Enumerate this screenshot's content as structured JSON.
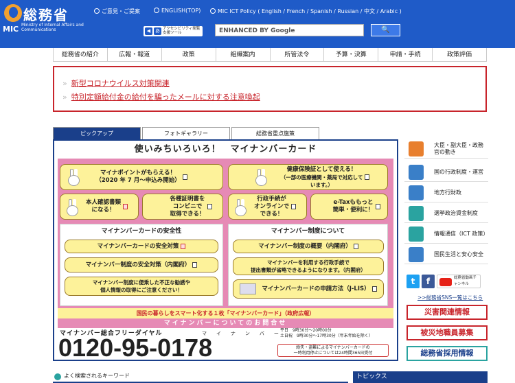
{
  "header": {
    "logo_jp": "総務省",
    "logo_mic": "MIC",
    "logo_en": "Ministry of Internal Affairs and Communications",
    "links": [
      "ご意見・ご提案",
      "ENGLISH(TOP)",
      "MIC ICT Policy ( English / French / Spanish / Russian / 中文 / Arabic )"
    ],
    "accessibility_label": "アクセシビリティ閲覧支援ツール",
    "search_placeholder": "ENHANCED BY Google",
    "search_button": "🔍"
  },
  "nav": [
    "総務省の紹介",
    "広報・報道",
    "政策",
    "組織案内",
    "所管法令",
    "予算・決算",
    "申請・手続",
    "政策評価"
  ],
  "notices": [
    "新型コロナウイルス対策関連",
    "特別定額給付金の給付を騙ったメールに対する注意喚起"
  ],
  "tabs": [
    "ピックアップ",
    "フォトギャラリー",
    "総務省重点施策"
  ],
  "panel": {
    "title": "使いみちいろいろ！　マイナンバーカード",
    "feature1_l1": "マイナポイントがもらえる！",
    "feature1_l2": "（2020 年 7 月～申込み開始）",
    "feature2_l1": "健康保険証として使える！",
    "feature2_l2": "（一部の医療機関・薬局で対応して",
    "feature2_l3": "います。）",
    "feature3_l1": "本人確認書類",
    "feature3_l2": "になる！",
    "feature4_l1": "各種証明書を",
    "feature4_l2": "コンビニで",
    "feature4_l3": "取得できる！",
    "feature5_l1": "行政手続が",
    "feature5_l2": "オンラインで",
    "feature5_l3": "できる！",
    "feature6_l1": "e-Taxももっと",
    "feature6_l2": "簡単・便利に！",
    "safety_heading": "マイナンバーカードの安全性",
    "safety_items": [
      "マイナンバーカードの安全対策",
      "マイナンバー制度の安全対策（内閣府）"
    ],
    "safety_warn_l1": "マイナンバー制度に便乗した不正な勧誘や",
    "safety_warn_l2": "個人情報の取得にご注意ください！",
    "system_heading": "マイナンバー制度について",
    "system_item1": "マイナンバー制度の概要（内閣府）",
    "system_item2_l1": "マイナンバーを利用する行政手続で",
    "system_item2_l2": "提出書類が省略できるようになります。（内閣府）",
    "system_item3": "マイナンバーカードの申請方法（J-LIS）",
    "strip": "国民の暮らしをスマート化する１枚「マイナンバーカード」（政府広報）",
    "inquiry": "マイナンバーについてのお問合せ",
    "dial_label": "マイナンバー総合フリーダイヤル",
    "phone": "0120-95-0178",
    "kana": "マイナンバー",
    "hours_l1": "平日　9時30分～20時00分",
    "hours_l2": "土日祝　9時30分～17時30分（年末年始を除く）",
    "fraud_l1": "紛失・盗難によるマイナンバーカードの",
    "fraud_l2": "一時利用停止については24時間365日受付"
  },
  "sidebar": [
    "大臣・副大臣・政務官の動き",
    "国の行政制度・運営",
    "地方行財政",
    "選挙政治資金制度",
    "情報通信（ICT 政策）",
    "国民生活と安心安全"
  ],
  "social": {
    "twitter": "t",
    "facebook": "f",
    "youtube": "総務省動画チャンネル",
    "sns_link": ">>総務省SNS一覧はこちら"
  },
  "buttons": [
    "災害関連情報",
    "被災地職員募集",
    "総務省採用情報"
  ],
  "bottom": {
    "keywords": "よく検索されるキーワード",
    "topics": "トピックス"
  },
  "colors": {
    "header_blue": "#1f5bc8",
    "navy": "#1a3f8a",
    "alert_red": "#c8242b",
    "pink": "#e68ab5",
    "yellow": "#fdf29a"
  }
}
